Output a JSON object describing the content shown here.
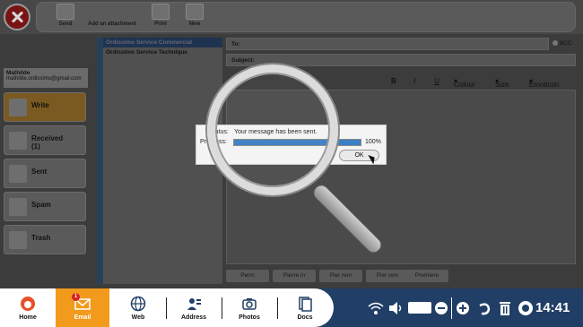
{
  "toolbar": {
    "send_label": "Send",
    "attach_label": "Add an attachment",
    "print_label": "Print",
    "new_label": "New"
  },
  "user": {
    "name": "Mathilde",
    "email": "mathilde.ordissimo@gmail.com"
  },
  "folders": [
    {
      "label": "Write"
    },
    {
      "label": "Received",
      "count": "(1)"
    },
    {
      "label": "Sent"
    },
    {
      "label": "Spam"
    },
    {
      "label": "Trash"
    }
  ],
  "contacts": [
    {
      "name": "Ordissimo Service Commercial"
    },
    {
      "name": "Ordissimo Service Technique"
    }
  ],
  "compose": {
    "to_label": "To:",
    "subject_label": "Subject:",
    "bcc_label": "BCC",
    "format": {
      "bold": "B",
      "italic": "I",
      "underline": "U",
      "colour": "Colour",
      "size": "Size",
      "emoticon": "Emoticon"
    },
    "buttons": [
      "Perm",
      "Pierre in",
      "Pier rem",
      "Pier rem",
      "Premiere"
    ]
  },
  "dialog": {
    "status_label": "Status:",
    "status_text": "Your message has been sent.",
    "progress_label": "Progress:",
    "progress_value": "100%",
    "progress_fraction": 1.0,
    "ok_label": "OK"
  },
  "taskbar": {
    "home": "Home",
    "email": "Email",
    "email_badge": "1",
    "web": "Web",
    "address": "Address",
    "photos": "Photos",
    "docs": "Docs",
    "clock": "14:41"
  },
  "colors": {
    "accent": "#f29a1c",
    "taskbar": "#213f66",
    "progress": "#3b7fc4"
  }
}
